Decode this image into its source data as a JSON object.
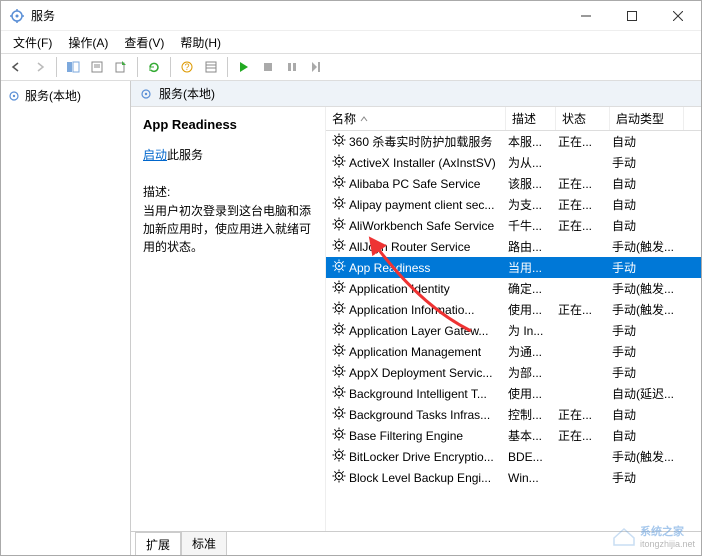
{
  "window": {
    "title": "服务"
  },
  "menu": {
    "file": "文件(F)",
    "action": "操作(A)",
    "view": "查看(V)",
    "help": "帮助(H)"
  },
  "leftpane": {
    "root": "服务(本地)"
  },
  "rtitle": "服务(本地)",
  "detail": {
    "name": "App Readiness",
    "start_link": "启动",
    "start_suffix": "此服务",
    "desc_label": "描述:",
    "desc_text": "当用户初次登录到这台电脑和添加新应用时，使应用进入就绪可用的状态。"
  },
  "columns": {
    "name": "名称",
    "desc": "描述",
    "status": "状态",
    "start": "启动类型"
  },
  "tabs": {
    "extended": "扩展",
    "standard": "标准"
  },
  "services": [
    {
      "name": "360 杀毒实时防护加载服务",
      "desc": "本服...",
      "status": "正在...",
      "start": "自动"
    },
    {
      "name": "ActiveX Installer (AxInstSV)",
      "desc": "为从...",
      "status": "",
      "start": "手动"
    },
    {
      "name": "Alibaba PC Safe Service",
      "desc": "该服...",
      "status": "正在...",
      "start": "自动"
    },
    {
      "name": "Alipay payment client sec...",
      "desc": "为支...",
      "status": "正在...",
      "start": "自动"
    },
    {
      "name": "AliWorkbench Safe Service",
      "desc": "千牛...",
      "status": "正在...",
      "start": "自动"
    },
    {
      "name": "AllJoyn Router Service",
      "desc": "路由...",
      "status": "",
      "start": "手动(触发..."
    },
    {
      "name": "App Readiness",
      "desc": "当用...",
      "status": "",
      "start": "手动",
      "selected": true
    },
    {
      "name": "Application Identity",
      "desc": "确定...",
      "status": "",
      "start": "手动(触发..."
    },
    {
      "name": "Application Informatio...",
      "desc": "使用...",
      "status": "正在...",
      "start": "手动(触发..."
    },
    {
      "name": "Application Layer Gatew...",
      "desc": "为 In...",
      "status": "",
      "start": "手动"
    },
    {
      "name": "Application Management",
      "desc": "为通...",
      "status": "",
      "start": "手动"
    },
    {
      "name": "AppX Deployment Servic...",
      "desc": "为部...",
      "status": "",
      "start": "手动"
    },
    {
      "name": "Background Intelligent T...",
      "desc": "使用...",
      "status": "",
      "start": "自动(延迟..."
    },
    {
      "name": "Background Tasks Infras...",
      "desc": "控制...",
      "status": "正在...",
      "start": "自动"
    },
    {
      "name": "Base Filtering Engine",
      "desc": "基本...",
      "status": "正在...",
      "start": "自动"
    },
    {
      "name": "BitLocker Drive Encryptio...",
      "desc": "BDE...",
      "status": "",
      "start": "手动(触发..."
    },
    {
      "name": "Block Level Backup Engi...",
      "desc": "Win...",
      "status": "",
      "start": "手动"
    }
  ],
  "watermark": {
    "brand": "系统之家",
    "url": "itongzhijia.net"
  }
}
